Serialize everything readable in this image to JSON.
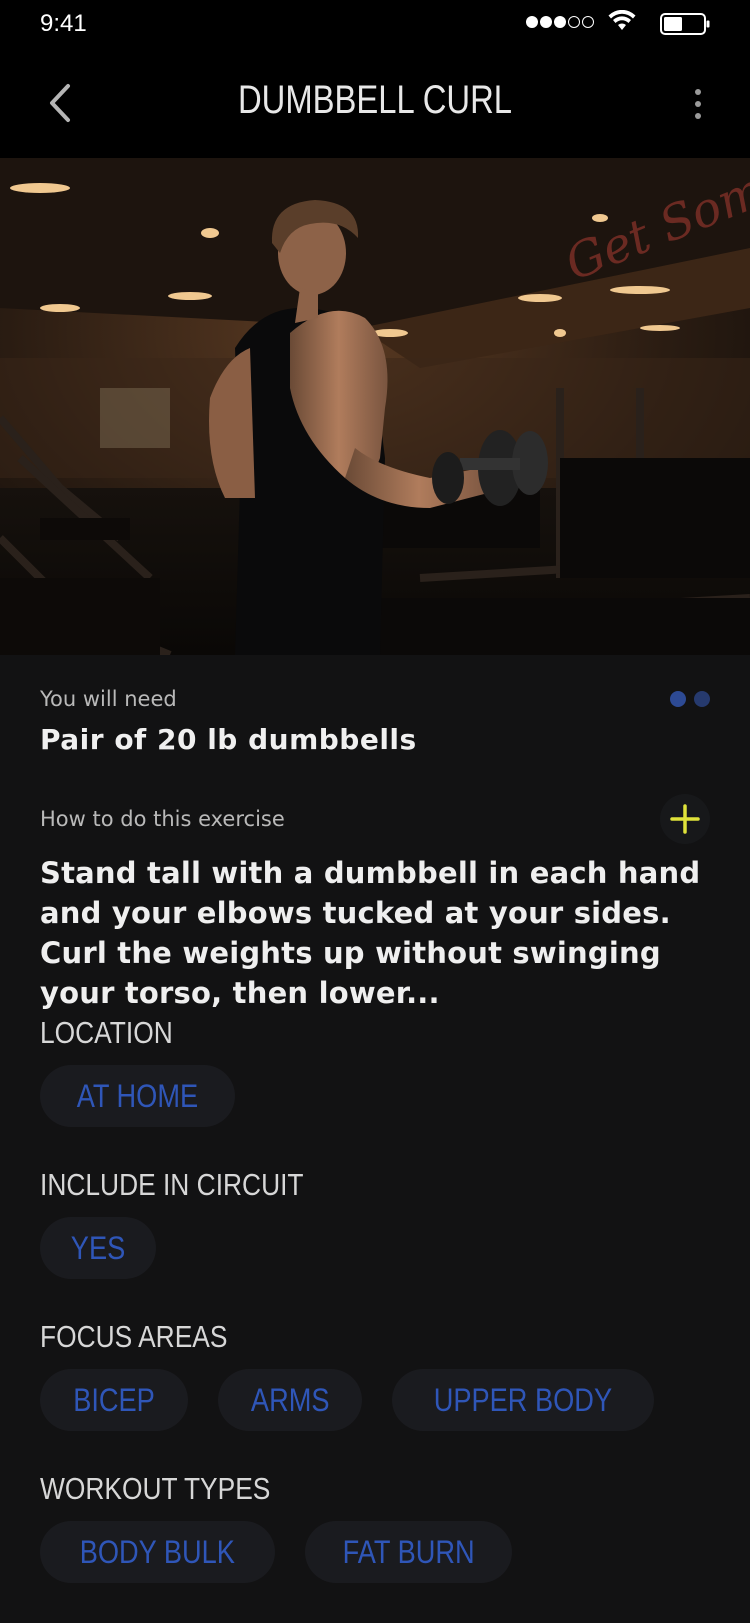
{
  "status_bar": {
    "time": "9:41"
  },
  "header": {
    "title": "DUMBBELL CURL"
  },
  "hero": {
    "image_description_icon": "gym-photo"
  },
  "equipment": {
    "label": "You will need",
    "value": "Pair of 20 lb dumbbells"
  },
  "pager": {
    "total": 2,
    "active": 1
  },
  "instructions": {
    "label": "How to do this exercise",
    "text": "Stand tall with a dumbbell in each hand and your elbows tucked at your sides. Curl the weights up without swinging your torso, then lower..."
  },
  "sections": {
    "location": {
      "title": "LOCATION",
      "chips": [
        "AT HOME"
      ]
    },
    "circuit": {
      "title": "INCLUDE IN CIRCUIT",
      "chips": [
        "YES"
      ]
    },
    "focus": {
      "title": "FOCUS AREAS",
      "chips": [
        "BICEP",
        "ARMS",
        "UPPER BODY"
      ]
    },
    "workout": {
      "title": "WORKOUT TYPES",
      "chips": [
        "BODY BULK",
        "FAT BURN"
      ]
    }
  },
  "colors": {
    "accent_blue": "#2f56b8",
    "plus_yellow": "#dfe23a",
    "background": "#121213"
  }
}
